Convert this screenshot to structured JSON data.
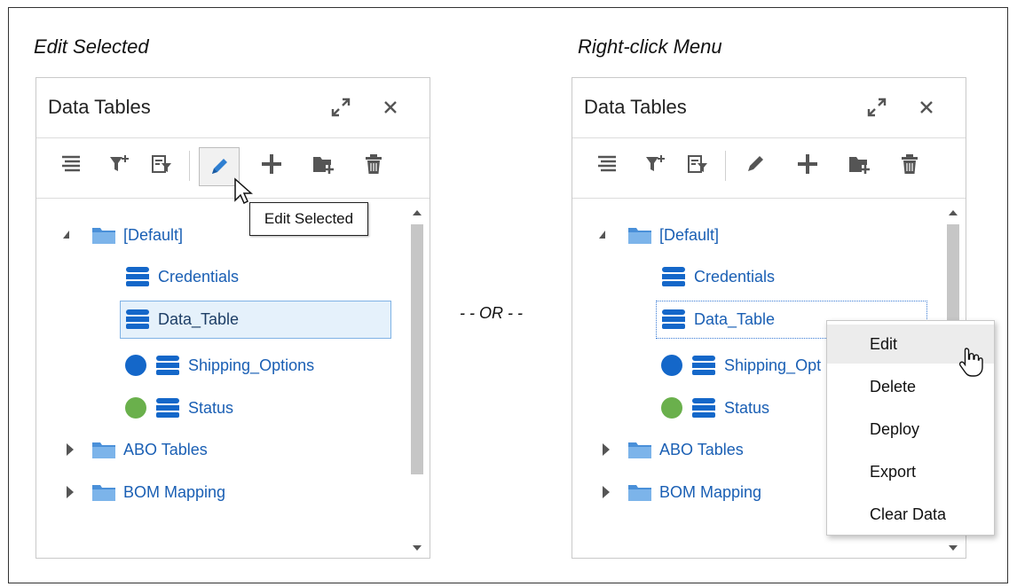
{
  "left_caption": "Edit Selected",
  "right_caption": "Right-click Menu",
  "separator": "- - OR - -",
  "panel_title": "Data Tables",
  "tooltip": "Edit Selected",
  "tree": {
    "default_folder": "[Default]",
    "credentials": "Credentials",
    "data_table": "Data_Table",
    "shipping_options": "Shipping_Options",
    "shipping_options_truncated": "Shipping_Opt",
    "status": "Status",
    "abo_tables": "ABO Tables",
    "bom_mapping": "BOM Mapping"
  },
  "context_menu": [
    "Edit",
    "Delete",
    "Deploy",
    "Export",
    "Clear Data"
  ],
  "colors": {
    "link_blue": "#1a5fb4",
    "folder_blue": "#4a90d9",
    "status_blue": "#1467c9",
    "status_green": "#6ab04c",
    "icon_gray": "#555555"
  }
}
